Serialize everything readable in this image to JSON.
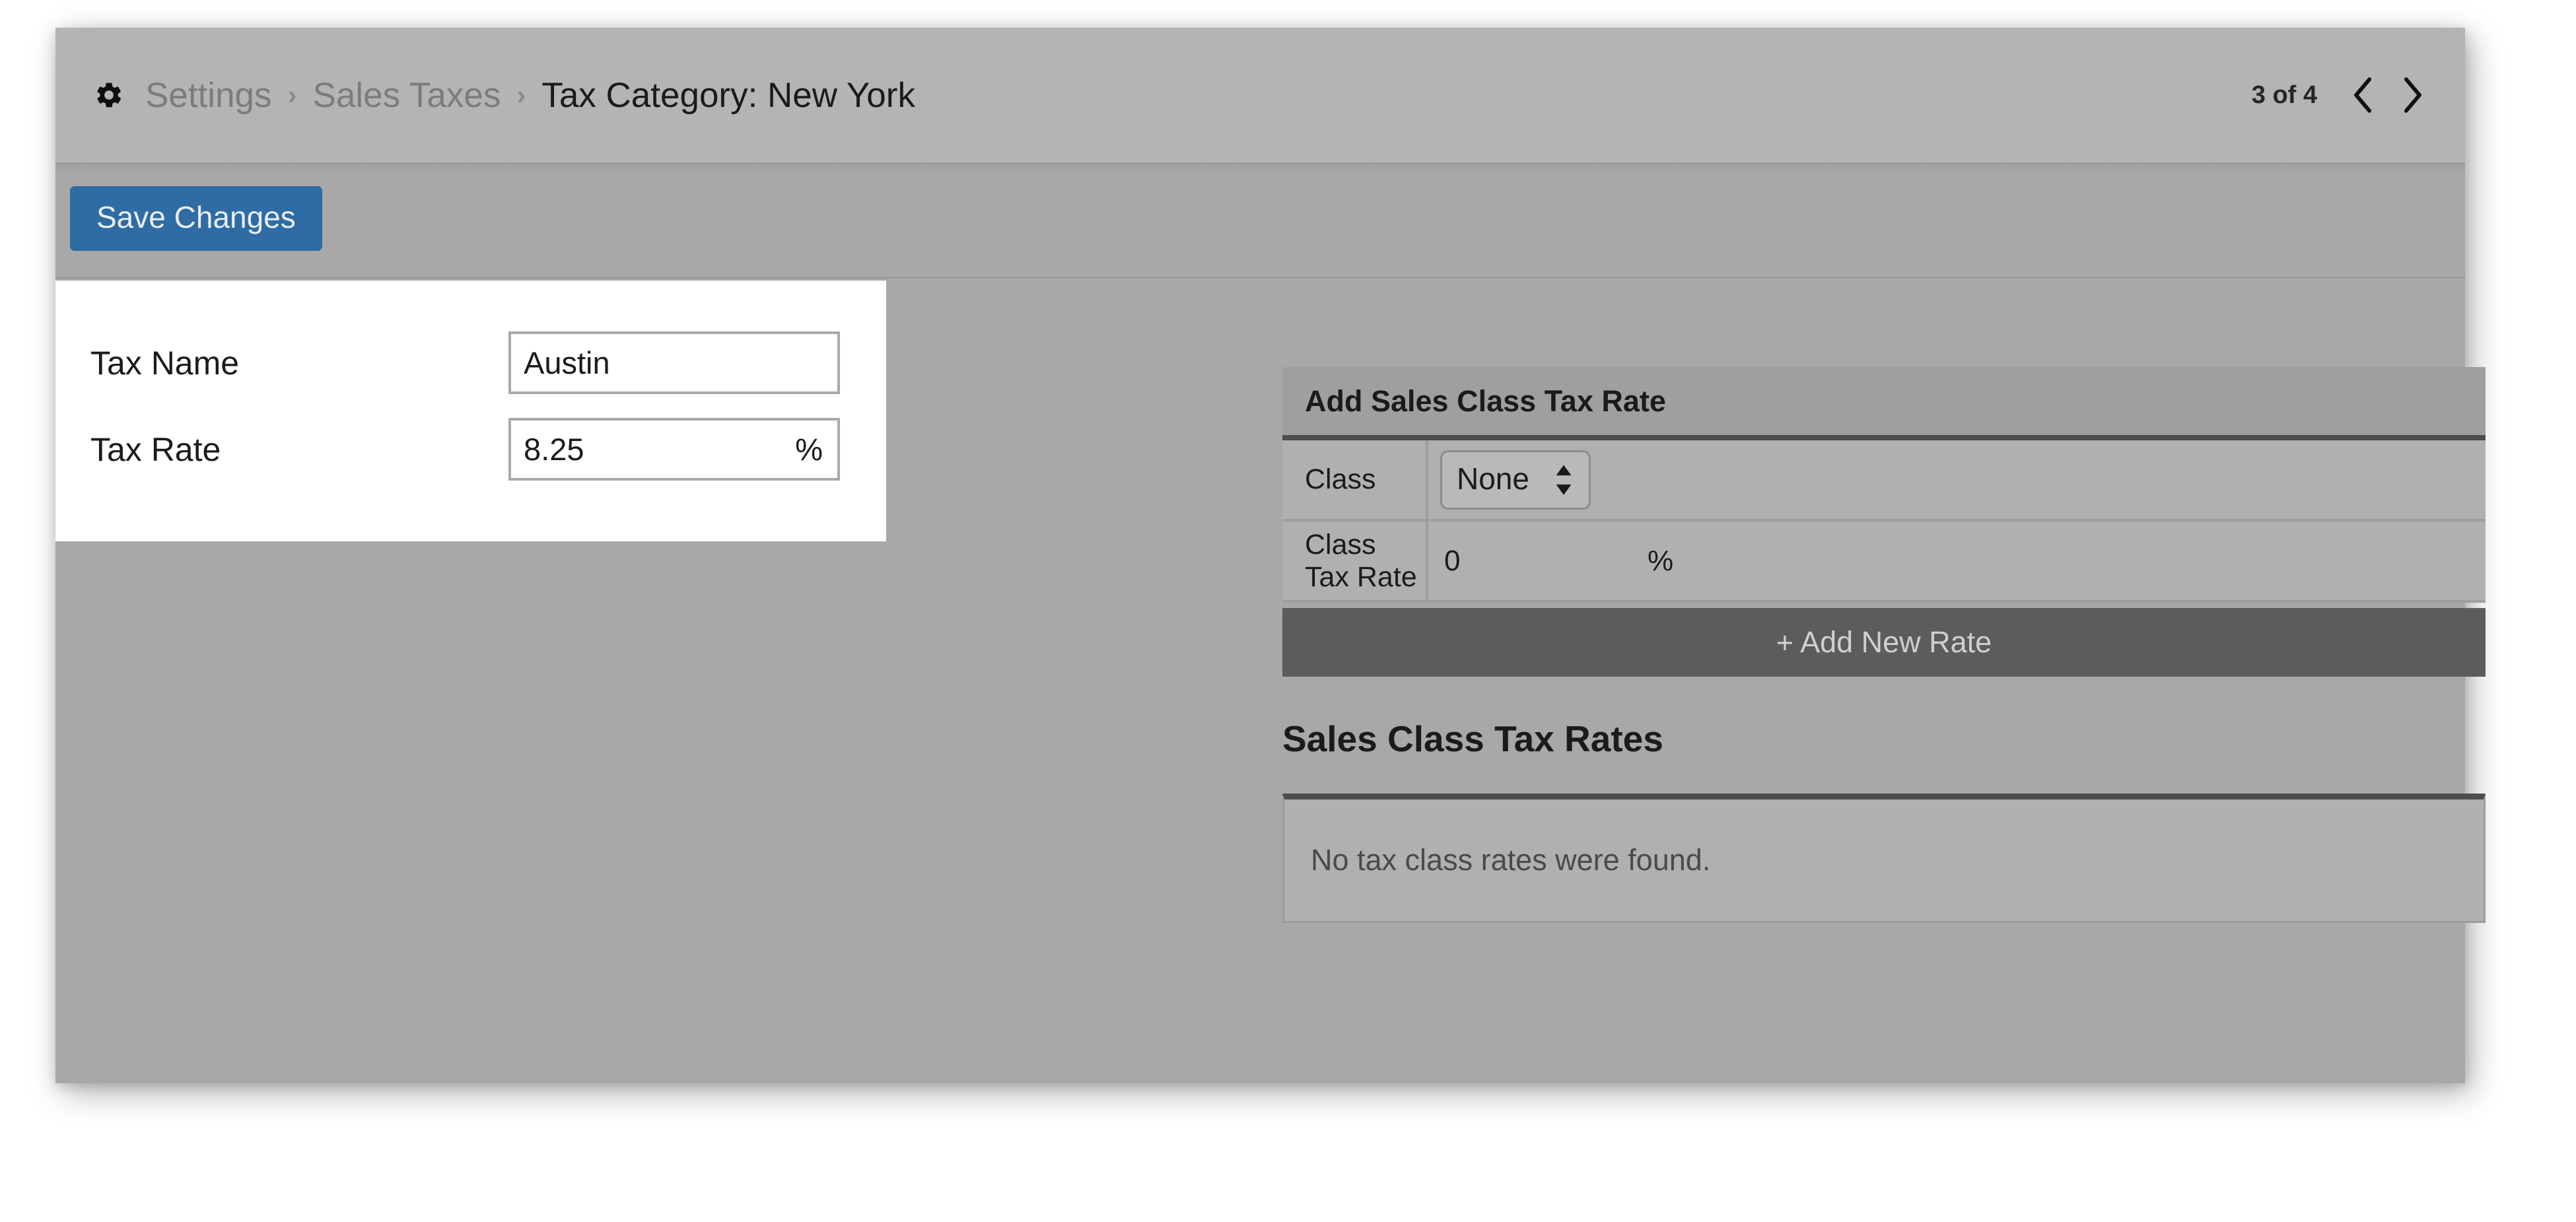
{
  "header": {
    "gear_icon": "gear-icon",
    "breadcrumb": [
      {
        "label": "Settings",
        "active": false
      },
      {
        "label": "Sales Taxes",
        "active": false
      },
      {
        "label": "Tax Category: New York",
        "active": true
      }
    ],
    "separator": "›",
    "pager": {
      "count_label": "3 of 4",
      "prev_icon": "chevron-left-icon",
      "next_icon": "chevron-right-icon"
    }
  },
  "toolbar": {
    "save_label": "Save Changes"
  },
  "form": {
    "tax_name": {
      "label": "Tax Name",
      "value": "Austin",
      "placeholder": ""
    },
    "tax_rate": {
      "label": "Tax Rate",
      "value": "8.25",
      "placeholder": "",
      "suffix": "%"
    }
  },
  "add_rate_panel": {
    "title": "Add Sales Class Tax Rate",
    "class_row": {
      "label": "Class",
      "selected": "None",
      "options": [
        "None"
      ]
    },
    "class_tax_rate_row": {
      "label": "Class Tax Rate",
      "value": "0",
      "suffix": "%"
    },
    "add_button": {
      "plus": "+",
      "label": "Add New Rate"
    }
  },
  "rates_section": {
    "heading": "Sales Class Tax Rates",
    "empty_message": "No tax class rates were found."
  },
  "colors": {
    "accent_blue": "#2e6ca3",
    "dark_button": "#5c5c5c",
    "window_bg": "#a8a8a8",
    "header_bg": "#b4b4b4",
    "panel_bg": "#b0b0b0",
    "field_bg": "#ffffff"
  }
}
